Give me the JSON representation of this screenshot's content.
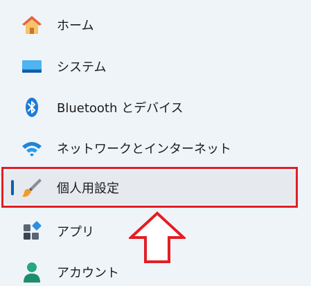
{
  "nav": {
    "items": [
      {
        "label": "ホーム",
        "icon": "home-icon"
      },
      {
        "label": "システム",
        "icon": "system-icon"
      },
      {
        "label": "Bluetooth とデバイス",
        "icon": "bluetooth-icon"
      },
      {
        "label": "ネットワークとインターネット",
        "icon": "wifi-icon"
      },
      {
        "label": "個人用設定",
        "icon": "paintbrush-icon",
        "selected": true
      },
      {
        "label": "アプリ",
        "icon": "apps-icon"
      },
      {
        "label": "アカウント",
        "icon": "account-icon"
      }
    ]
  },
  "colors": {
    "background": "#eff4f9",
    "selected_background": "#e6e9ee",
    "accent": "#005fb8",
    "annotation_red": "#e31e24"
  }
}
